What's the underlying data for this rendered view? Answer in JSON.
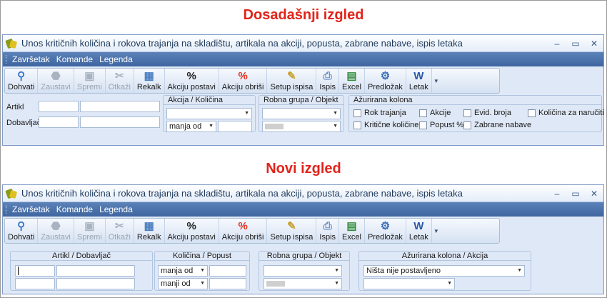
{
  "headings": {
    "old": "Dosadašnji izgled",
    "new": "Novi izgled"
  },
  "window": {
    "title": "Unos kritičnih količina i rokova trajanja na skladištu, artikala na akciji, popusta, zabrane nabave, ispis letaka",
    "controls": [
      "–",
      "▭",
      "✕"
    ]
  },
  "menu": [
    "Završetak",
    "Komande",
    "Legenda"
  ],
  "toolbar": [
    {
      "label": "Dohvati",
      "icon": "search-icon",
      "enabled": true
    },
    {
      "label": "Zaustavi",
      "icon": "stop-icon",
      "enabled": false
    },
    {
      "label": "Spremi",
      "icon": "save-icon",
      "enabled": false
    },
    {
      "label": "Otkaži",
      "icon": "cancel-icon",
      "enabled": false
    },
    {
      "label": "Rekalk",
      "icon": "calculator-icon",
      "enabled": true
    },
    {
      "label": "Akciju postavi",
      "icon": "percent-icon",
      "enabled": true
    },
    {
      "label": "Akciju obriši",
      "icon": "percent-red-icon",
      "enabled": true
    },
    {
      "label": "Setup ispisa",
      "icon": "page-setup-icon",
      "enabled": true
    },
    {
      "label": "Ispis",
      "icon": "printer-icon",
      "enabled": true
    },
    {
      "label": "Excel",
      "icon": "excel-icon",
      "enabled": true
    },
    {
      "label": "Predložak",
      "icon": "template-gear-icon",
      "enabled": true
    },
    {
      "label": "Letak",
      "icon": "word-icon",
      "enabled": true
    }
  ],
  "icon_colors": {
    "search-icon": "#3a78c8",
    "stop-icon": "#8a8a8a",
    "save-icon": "#9fb0c8",
    "cancel-icon": "#a0a0a0",
    "calculator-icon": "#4a7fc0",
    "percent-icon": "#222222",
    "percent-red-icon": "#e03020",
    "page-setup-icon": "#c8a030",
    "printer-icon": "#6a8fc0",
    "excel-icon": "#2e8b3a",
    "template-gear-icon": "#3a70b8",
    "word-icon": "#2a5aa8"
  },
  "old_filters": {
    "label_artikl": "Artikl",
    "label_dobavljac": "Dobavljač",
    "group_akcija_title": "Akcija / Količina",
    "akcija_operator": "manja od",
    "group_robna_title": "Robna grupa / Objekt",
    "group_azurirana_title": "Ažurirana kolona",
    "checkboxes": [
      "Rok trajanja",
      "Akcije",
      "Evid. broja",
      "Količina za naručiti",
      "Kritične količine",
      "Popust %",
      "Zabrane nabave"
    ]
  },
  "new_filters": {
    "group_artikl_title": "Artikl / Dobavljač",
    "group_kolicina_title": "Količina / Popust",
    "kolicina_operator": "manja od",
    "popust_operator": "manji od",
    "group_robna_title": "Robna grupa / Objekt",
    "group_azurirana_title": "Ažurirana kolona / Akcija",
    "azurirana_value": "Ništa nije postavljeno"
  }
}
